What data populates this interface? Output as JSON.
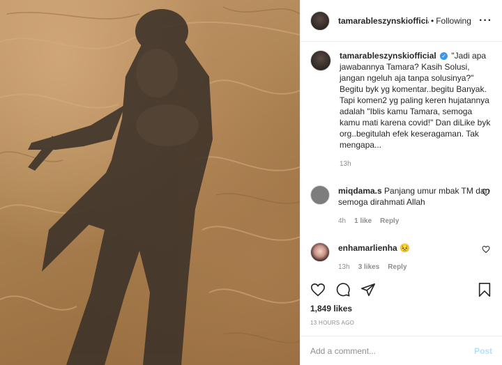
{
  "header": {
    "username": "tamarableszynskiofficial",
    "separator": "•",
    "follow_label": "Following",
    "more_icon": "more-horizontal-icon"
  },
  "caption": {
    "username": "tamarableszynskiofficial",
    "verified_icon": "verified-badge-icon",
    "text": "\"Jadi apa jawabannya Tamara? Kasih Solusi, jangan ngeluh aja tanpa solusinya?\" Begitu byk yg komentar..begitu Banyak. Tapi komen2 yg paling keren hujatannya adalah \"Iblis kamu Tamara, semoga kamu mati karena covid!\" Dan diLike byk org..begitulah efek keseragaman. Tak mengapa...",
    "time": "13h"
  },
  "comments": [
    {
      "username": "miqdama.s",
      "text": "Panjang umur mbak TM dan semoga dirahmati Allah",
      "time": "4h",
      "likes": "1 like",
      "reply": "Reply"
    },
    {
      "username": "enhamarlienha",
      "text": "😣",
      "time": "13h",
      "likes": "3 likes",
      "reply": "Reply"
    }
  ],
  "actions": {
    "icons": [
      "heart-icon",
      "comment-icon",
      "share-icon",
      "bookmark-icon"
    ]
  },
  "likes_count": "1,849 likes",
  "time_ago": "13 HOURS AGO",
  "add_comment": {
    "placeholder": "Add a comment...",
    "post_label": "Post"
  },
  "colors": {
    "verified": "#3897f0",
    "post_button_disabled": "#b2dffc",
    "muted_text": "#8e8e8e"
  }
}
